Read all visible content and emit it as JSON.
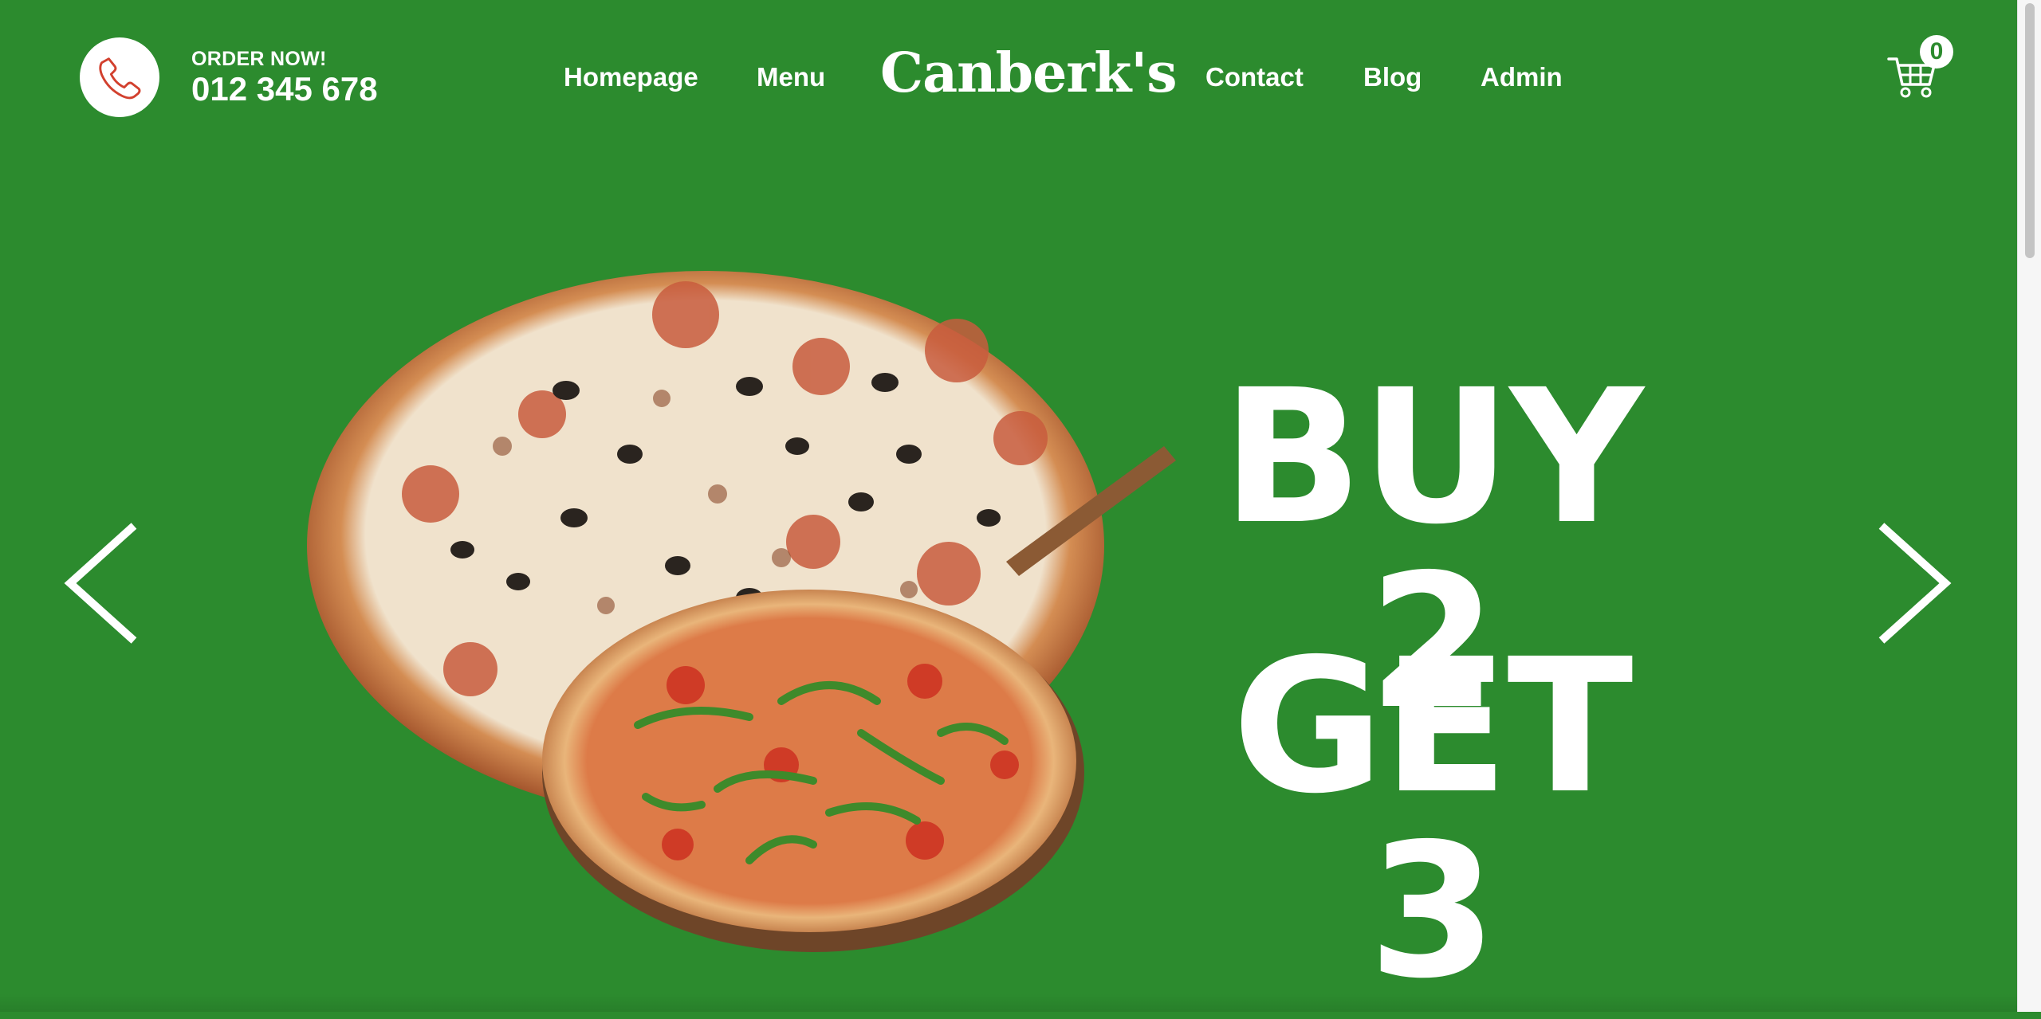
{
  "header": {
    "order_label": "ORDER NOW!",
    "order_number": "012 345 678",
    "logo": "Canberk's",
    "nav": {
      "homepage": "Homepage",
      "menu": "Menu",
      "contact": "Contact",
      "blog": "Blog",
      "admin": "Admin"
    },
    "cart_count": "0",
    "phone_icon": "phone-icon",
    "cart_icon": "cart-icon"
  },
  "hero": {
    "line1": "BUY 2",
    "line2": "GET 3",
    "prev_icon": "chevron-left-icon",
    "next_icon": "chevron-right-icon",
    "image": "pizza-image"
  },
  "colors": {
    "background": "#2c8b2e",
    "text": "#ffffff",
    "phone_icon": "#d2402e"
  }
}
